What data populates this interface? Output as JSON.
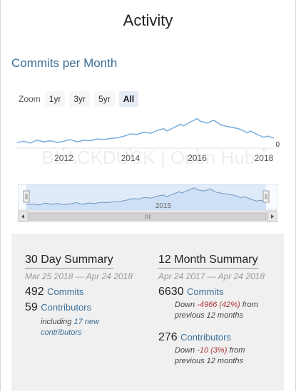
{
  "page": {
    "title": "Activity"
  },
  "commits_chart": {
    "title": "Commits per Month",
    "zoom": {
      "label": "Zoom",
      "buttons": [
        "1yr",
        "3yr",
        "5yr",
        "All"
      ],
      "active": "All"
    },
    "x_ticks": [
      "2012",
      "2014",
      "2016",
      "2018"
    ],
    "y_last_label": "0",
    "navigator_tick": "2015",
    "watermark": "BLACKDUCK | Open Hub",
    "colors": {
      "line": "#7eb0de",
      "fill": "#c4dcf4",
      "navigator_mask": "#cfe1f5"
    }
  },
  "chart_data": {
    "type": "line",
    "title": "Commits per Month",
    "xlabel": "",
    "ylabel": "",
    "x_tick_labels": [
      "2012",
      "2014",
      "2016",
      "2018"
    ],
    "x_range": [
      2010.6,
      2018.3
    ],
    "series": [
      {
        "values": [
          [
            2010.6,
            10
          ],
          [
            2010.8,
            12
          ],
          [
            2011.0,
            9
          ],
          [
            2011.2,
            14
          ],
          [
            2011.4,
            11
          ],
          [
            2011.6,
            13
          ],
          [
            2011.8,
            10
          ],
          [
            2012.0,
            12
          ],
          [
            2012.2,
            15
          ],
          [
            2012.4,
            11
          ],
          [
            2012.6,
            14
          ],
          [
            2012.8,
            13
          ],
          [
            2013.0,
            16
          ],
          [
            2013.2,
            15
          ],
          [
            2013.4,
            17
          ],
          [
            2013.6,
            18
          ],
          [
            2013.8,
            21
          ],
          [
            2014.0,
            25
          ],
          [
            2014.2,
            24
          ],
          [
            2014.4,
            28
          ],
          [
            2014.6,
            26
          ],
          [
            2014.8,
            31
          ],
          [
            2015.0,
            34
          ],
          [
            2015.1,
            30
          ],
          [
            2015.3,
            36
          ],
          [
            2015.5,
            42
          ],
          [
            2015.6,
            39
          ],
          [
            2015.8,
            46
          ],
          [
            2016.0,
            52
          ],
          [
            2016.1,
            47
          ],
          [
            2016.3,
            44
          ],
          [
            2016.5,
            49
          ],
          [
            2016.7,
            41
          ],
          [
            2016.9,
            38
          ],
          [
            2017.1,
            36
          ],
          [
            2017.3,
            33
          ],
          [
            2017.5,
            27
          ],
          [
            2017.6,
            30
          ],
          [
            2017.8,
            24
          ],
          [
            2018.0,
            19
          ],
          [
            2018.1,
            21
          ],
          [
            2018.3,
            18
          ]
        ]
      }
    ]
  },
  "summary_30": {
    "heading": "30 Day Summary",
    "date_range": "Mar 25 2018 — Apr 24 2018",
    "commits_count": "492",
    "commits_label": "Commits",
    "contributors_count": "59",
    "contributors_label": "Contributors",
    "including_prefix": "including",
    "new_contributors": "17 new contributors"
  },
  "summary_12": {
    "heading": "12 Month Summary",
    "date_range": "Apr 24 2017 — Apr 24 2018",
    "commits_count": "6630",
    "commits_label": "Commits",
    "commits_down_prefix": "Down",
    "commits_down_value": "-4966 (42%)",
    "commits_down_suffix": "from",
    "commits_down_tail": "previous 12 months",
    "contributors_count": "276",
    "contributors_label": "Contributors",
    "contributors_down_prefix": "Down",
    "contributors_down_value": "-10 (3%)",
    "contributors_down_suffix": "from",
    "contributors_down_tail": "previous 12 months"
  }
}
